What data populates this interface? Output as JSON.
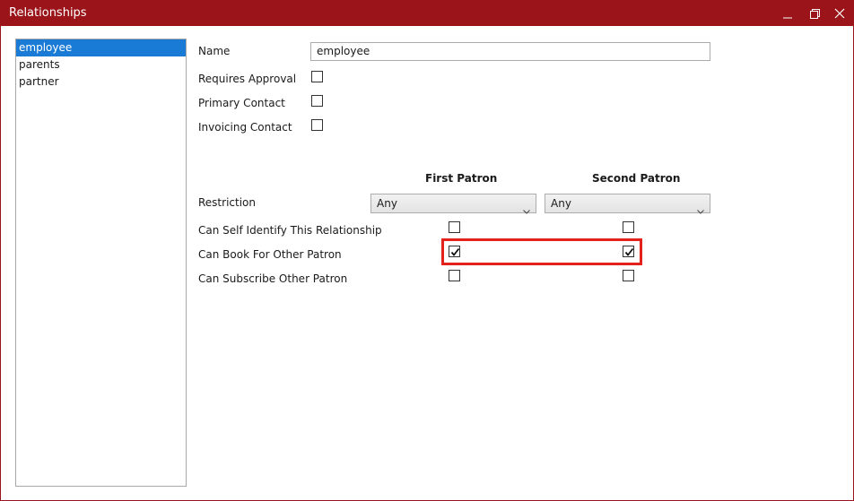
{
  "window": {
    "title": "Relationships",
    "controls": [
      "minimize-icon",
      "maximize-icon",
      "close-icon"
    ],
    "accent_color": "#9b1419"
  },
  "relationship_list": {
    "items": [
      {
        "label": "employee",
        "selected": true
      },
      {
        "label": "parents",
        "selected": false
      },
      {
        "label": "partner",
        "selected": false
      }
    ],
    "selection_color": "#1a7bd6"
  },
  "form": {
    "name_label": "Name",
    "name_value": "employee",
    "requires_approval_label": "Requires Approval",
    "requires_approval": false,
    "primary_contact_label": "Primary Contact",
    "primary_contact": false,
    "invoicing_contact_label": "Invoicing Contact",
    "invoicing_contact": false
  },
  "patron_table": {
    "first_header": "First Patron",
    "second_header": "Second Patron",
    "restriction_label": "Restriction",
    "restriction_first": "Any",
    "restriction_second": "Any",
    "rows": [
      {
        "label": "Can Self Identify This Relationship",
        "first": false,
        "second": false
      },
      {
        "label": "Can Book For Other Patron",
        "first": true,
        "second": true
      },
      {
        "label": "Can Subscribe Other Patron",
        "first": false,
        "second": false
      }
    ],
    "highlight_color": "#e3231b"
  }
}
